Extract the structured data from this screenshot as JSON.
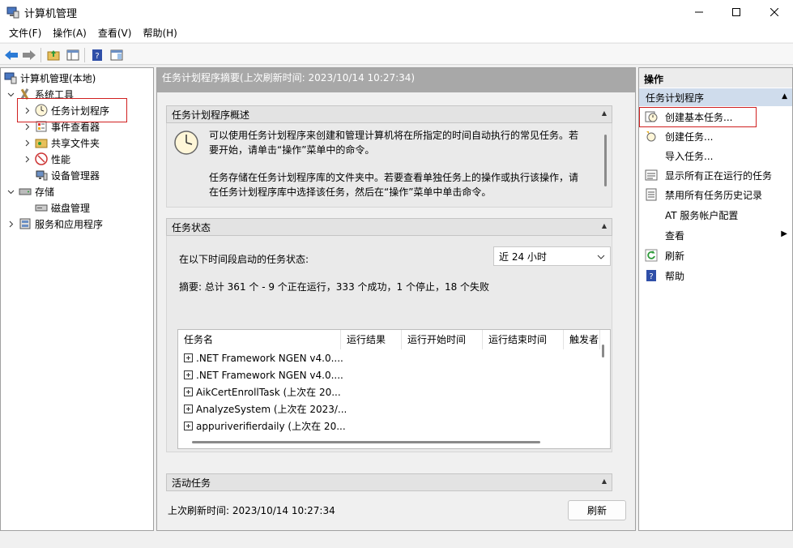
{
  "window": {
    "title": "计算机管理"
  },
  "menu": [
    "文件(F)",
    "操作(A)",
    "查看(V)",
    "帮助(H)"
  ],
  "tree": {
    "root": "计算机管理(本地)",
    "system_tools": "系统工具",
    "task_scheduler": "任务计划程序",
    "event_viewer": "事件查看器",
    "shared_folders": "共享文件夹",
    "performance": "性能",
    "device_manager": "设备管理器",
    "storage": "存储",
    "disk_management": "磁盘管理",
    "services_apps": "服务和应用程序"
  },
  "center": {
    "header": "任务计划程序摘要(上次刷新时间: 2023/10/14 10:27:34)",
    "overview_title": "任务计划程序概述",
    "overview_p1_line1": "可以使用任务计划程序来创建和管理计算机将在所指定的时间自动执行的常见任务。若",
    "overview_p1_line2": "要开始，请单击“操作”菜单中的命令。",
    "overview_p2_line1": "任务存储在任务计划程序库的文件夹中。若要查看单独任务上的操作或执行该操作，请",
    "overview_p2_line2": "在任务计划程序库中选择该任务，然后在“操作”菜单中单击命令。",
    "status_title": "任务状态",
    "status_label": "在以下时间段启动的任务状态:",
    "period_selected": "近 24 小时",
    "summary": "摘要: 总计 361 个 - 9 个正在运行，333 个成功，1 个停止，18 个失败",
    "table_headers": [
      "任务名",
      "运行结果",
      "运行开始时间",
      "运行结束时间",
      "触发者"
    ],
    "tasks": [
      ".NET Framework NGEN v4.0....",
      ".NET Framework NGEN v4.0....",
      "AikCertEnrollTask (上次在 20...",
      "AnalyzeSystem (上次在 2023/...",
      "appuriverifierdaily (上次在 20..."
    ],
    "active_title": "活动任务",
    "last_refresh": "上次刷新时间: 2023/10/14 10:27:34",
    "refresh_button": "刷新"
  },
  "actions": {
    "title": "操作",
    "section": "任务计划程序",
    "items": [
      {
        "label": "创建基本任务...",
        "icon": "create-basic-task-icon"
      },
      {
        "label": "创建任务...",
        "icon": "create-task-icon"
      },
      {
        "label": "导入任务...",
        "icon": ""
      },
      {
        "label": "显示所有正在运行的任务",
        "icon": "running-tasks-icon"
      },
      {
        "label": "禁用所有任务历史记录",
        "icon": "history-icon"
      },
      {
        "label": "AT 服务帐户配置",
        "icon": ""
      },
      {
        "label": "查看",
        "icon": ""
      },
      {
        "label": "刷新",
        "icon": "refresh-icon"
      },
      {
        "label": "帮助",
        "icon": "help-icon"
      }
    ]
  },
  "colors": {
    "highlight_border": "#d02020",
    "header_gray": "#a8a8a8",
    "selection_blue": "#cfdcec"
  }
}
